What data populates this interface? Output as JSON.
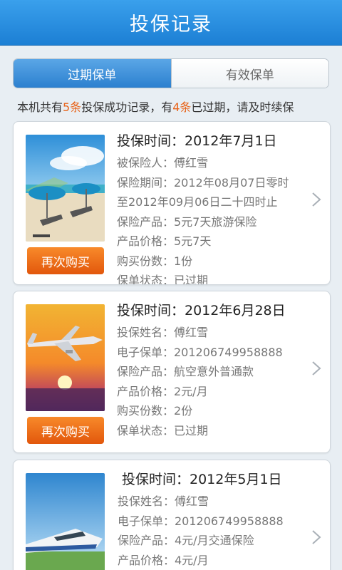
{
  "header": {
    "title": "投保记录"
  },
  "tabs": [
    {
      "label": "过期保单",
      "active": true
    },
    {
      "label": "有效保单",
      "active": false
    }
  ],
  "notice": {
    "prefix": "本机共有",
    "total": "5条",
    "middle": "投保成功记录，有",
    "expired": "4条",
    "suffix": "已过期，请及时续保"
  },
  "records": [
    {
      "head": "投保时间：2012年7月1日",
      "rows": [
        "被保险人：傅红雪",
        "保险期间：2012年08月07日零时",
        "至2012年09月06日二十四时止",
        "保险产品：5元7天旅游保险",
        "产品价格：5元7天",
        "购买份数：1份",
        "保单状态：已过期"
      ],
      "button": "再次购买",
      "image": "beach-umbrella"
    },
    {
      "head": "投保时间：2012年6月28日",
      "rows": [
        "投保姓名：傅红雪",
        "电子保单：201206749958888",
        "保险产品：航空意外普通款",
        "产品价格：2元/月",
        "购买份数：2份",
        "保单状态：已过期"
      ],
      "button": "再次购买",
      "image": "airplane-sunset"
    },
    {
      "head": "投保时间：2012年5月1日",
      "rows": [
        "投保姓名：傅红雪",
        "电子保单：201206749958888",
        "保险产品：4元/月交通保险",
        "产品价格：4元/月"
      ],
      "button": "",
      "image": "bullet-train"
    }
  ],
  "colors": {
    "accent": "#2c80cf",
    "highlight": "#e8641a",
    "button": "#f07a20"
  }
}
